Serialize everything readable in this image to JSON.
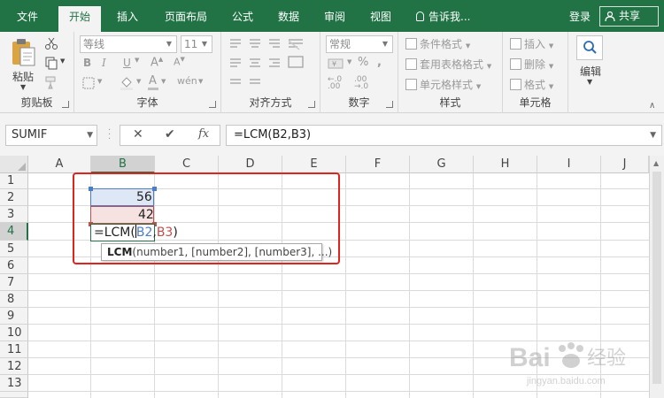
{
  "menu": {
    "tabs": [
      "文件",
      "开始",
      "插入",
      "页面布局",
      "公式",
      "数据",
      "审阅",
      "视图"
    ],
    "active_tab": "开始",
    "tell_me": "告诉我...",
    "login": "登录",
    "share": "共享"
  },
  "ribbon": {
    "clipboard": {
      "label": "剪贴板",
      "paste": "粘贴"
    },
    "font": {
      "label": "字体",
      "font_name": "等线",
      "font_size": "11"
    },
    "alignment": {
      "label": "对齐方式"
    },
    "number": {
      "label": "数字",
      "format": "常规"
    },
    "styles": {
      "label": "样式",
      "conditional": "条件格式",
      "table": "套用表格格式",
      "cell_styles": "单元格样式"
    },
    "cells": {
      "label": "单元格",
      "insert": "插入",
      "delete": "删除",
      "format": "格式"
    },
    "editing": {
      "label": "编辑"
    }
  },
  "formula_bar": {
    "name_box": "SUMIF",
    "cancel": "✕",
    "enter": "✔",
    "fx": "fx",
    "formula": "=LCM(B2,B3)"
  },
  "grid": {
    "columns": [
      "A",
      "B",
      "C",
      "D",
      "E",
      "F",
      "G",
      "H",
      "I",
      "J"
    ],
    "rows": [
      "1",
      "2",
      "3",
      "4",
      "5",
      "6",
      "7",
      "8",
      "9",
      "10",
      "11",
      "12",
      "13"
    ],
    "cells": {
      "B2": "56",
      "B3": "42"
    },
    "editing_cell": {
      "prefix": "=LCM(",
      "ref1": "B2",
      "sep": ",",
      "ref2": "B3",
      "suffix": ")"
    },
    "tooltip": {
      "func": "LCM",
      "args": "(number1, [number2], [number3], ...)"
    }
  },
  "colors": {
    "brand_green": "#217346",
    "ref_blue": "#4a7ec9",
    "ref_red": "#c0504d",
    "highlight_box": "#e0231c"
  },
  "watermark": {
    "text": "Bai经验",
    "subtext": "jingyan.baidu.com"
  }
}
